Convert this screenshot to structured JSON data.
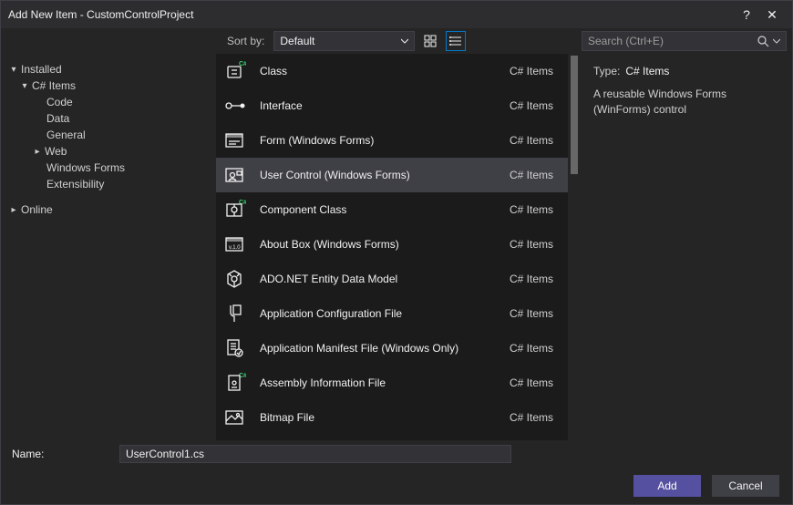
{
  "window": {
    "title": "Add New Item - CustomControlProject",
    "help_icon": "?",
    "close_icon": "✕"
  },
  "toolbar": {
    "sort_label": "Sort by:",
    "sort_value": "Default",
    "search_placeholder": "Search (Ctrl+E)"
  },
  "tree": {
    "installed": "Installed",
    "csitems": "C# Items",
    "children": [
      "Code",
      "Data",
      "General",
      "Web",
      "Windows Forms",
      "Extensibility"
    ],
    "online": "Online"
  },
  "items": [
    {
      "name": "Class",
      "cat": "C# Items",
      "icon": "class"
    },
    {
      "name": "Interface",
      "cat": "C# Items",
      "icon": "interface"
    },
    {
      "name": "Form (Windows Forms)",
      "cat": "C# Items",
      "icon": "form"
    },
    {
      "name": "User Control (Windows Forms)",
      "cat": "C# Items",
      "icon": "usercontrol",
      "selected": true
    },
    {
      "name": "Component Class",
      "cat": "C# Items",
      "icon": "component"
    },
    {
      "name": "About Box (Windows Forms)",
      "cat": "C# Items",
      "icon": "about"
    },
    {
      "name": "ADO.NET Entity Data Model",
      "cat": "C# Items",
      "icon": "ado"
    },
    {
      "name": "Application Configuration File",
      "cat": "C# Items",
      "icon": "config"
    },
    {
      "name": "Application Manifest File (Windows Only)",
      "cat": "C# Items",
      "icon": "manifest"
    },
    {
      "name": "Assembly Information File",
      "cat": "C# Items",
      "icon": "assembly"
    },
    {
      "name": "Bitmap File",
      "cat": "C# Items",
      "icon": "bitmap"
    }
  ],
  "details": {
    "type_label": "Type:",
    "type_value": "C# Items",
    "description": "A reusable Windows Forms (WinForms) control"
  },
  "footer": {
    "name_label": "Name:",
    "name_value": "UserControl1.cs",
    "add_label": "Add",
    "cancel_label": "Cancel"
  }
}
